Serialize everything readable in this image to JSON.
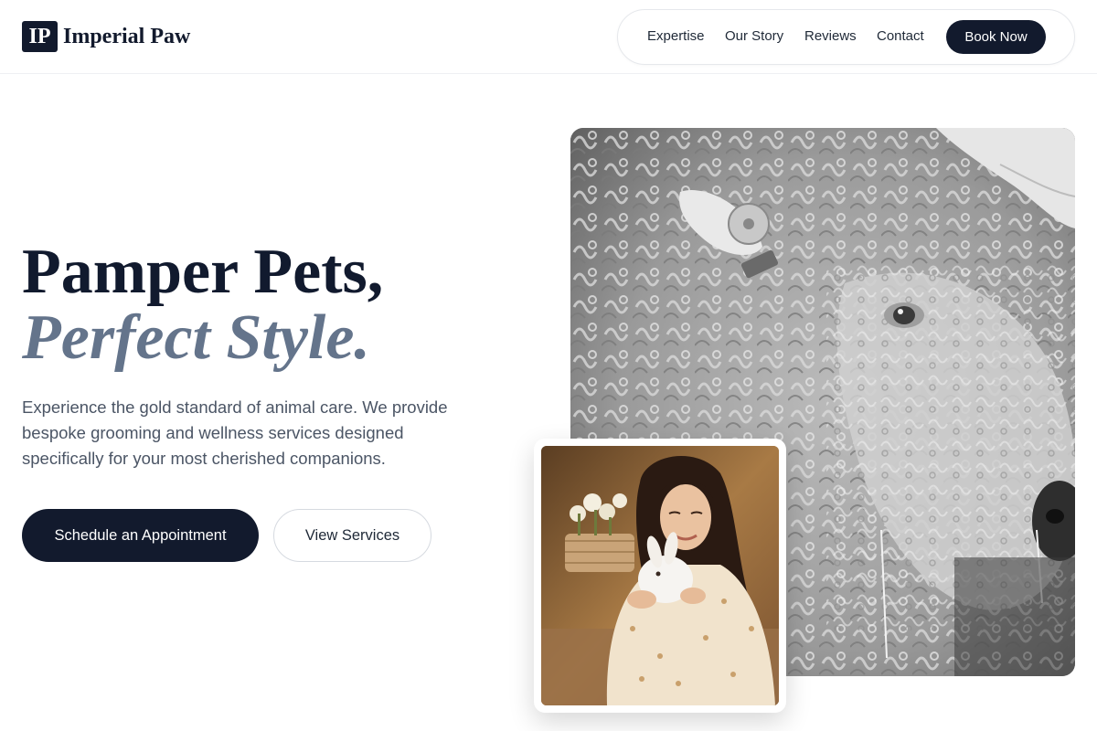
{
  "brand": {
    "mark": "IP",
    "name": "Imperial Paw"
  },
  "nav": {
    "items": [
      {
        "label": "Expertise"
      },
      {
        "label": "Our Story"
      },
      {
        "label": "Reviews"
      },
      {
        "label": "Contact"
      }
    ],
    "cta_label": "Book Now"
  },
  "hero": {
    "title_line1": "Pamper Pets,",
    "title_line2": "Perfect Style.",
    "description": "Experience the gold standard of animal care. We provide bespoke grooming and wellness services designed specifically for your most cherished companions.",
    "primary_button": "Schedule an Appointment",
    "secondary_button": "View Services"
  },
  "images": {
    "main": {
      "subject": "black-and-white close-up of a curly-fleeced sheep with an ear tag"
    },
    "inset": {
      "subject": "smiling woman holding a white rabbit"
    }
  },
  "colors": {
    "primary": "#121a2d",
    "accent_text": "#64748b",
    "body_text": "#4b5565",
    "background": "#ffffff"
  }
}
